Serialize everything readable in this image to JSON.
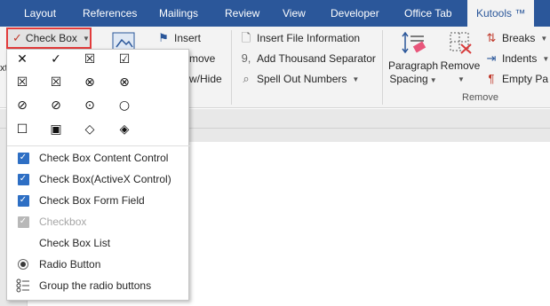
{
  "tabs": [
    "Layout",
    "References",
    "Mailings",
    "Review",
    "View",
    "Developer",
    "Office Tab",
    "Kutools ™"
  ],
  "ribbon": {
    "left_edge_text": "xt",
    "check_box_button": "Check Box",
    "insert": "Insert",
    "move_fragment": "move",
    "show_hide_fragment": "w/Hide",
    "insert_file_information": "Insert File Information",
    "add_thousand_separator": "Add Thousand Separator",
    "spell_out_numbers": "Spell Out Numbers",
    "paragraph_spacing_line1": "Paragraph",
    "paragraph_spacing_line2": "Spacing",
    "remove": "Remove",
    "breaks": "Breaks",
    "indents": "Indents",
    "empty_pa": "Empty Pa",
    "remove_group_label": "Remove"
  },
  "menu": {
    "symbols": [
      "✕",
      "✓",
      "☒",
      "☑",
      "☒",
      "☒",
      "⊗",
      "⊗",
      "⊘",
      "⊘",
      "⊙",
      "○",
      "☐",
      "▣",
      "◇",
      "◈"
    ],
    "items": [
      {
        "label": "Check Box Content Control",
        "icon": "checked-checkbox-icon",
        "enabled": true
      },
      {
        "label": "Check Box(ActiveX Control)",
        "icon": "checked-checkbox-icon",
        "enabled": true
      },
      {
        "label": "Check Box Form Field",
        "icon": "checked-checkbox-icon",
        "enabled": true
      },
      {
        "label": "Checkbox",
        "icon": "checked-checkbox-icon",
        "enabled": false
      },
      {
        "label": "Check Box List",
        "icon": "",
        "enabled": true
      },
      {
        "label": "Radio Button",
        "icon": "radio-button-icon",
        "enabled": true
      },
      {
        "label": "Group the radio buttons",
        "icon": "grouped-list-icon",
        "enabled": true
      }
    ]
  },
  "colors": {
    "tabbar": "#2b579a",
    "highlight_border": "#e23b3b",
    "checkbox_blue": "#2e6fc4"
  }
}
